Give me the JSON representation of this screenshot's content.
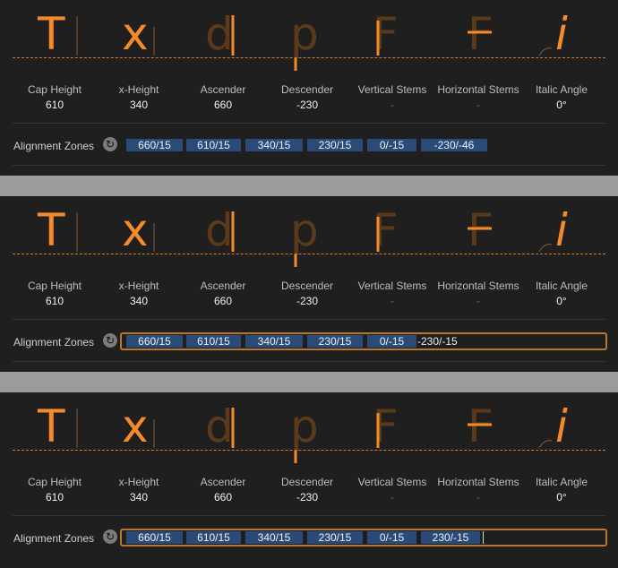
{
  "metrics": [
    {
      "label": "Cap Height",
      "value": "610"
    },
    {
      "label": "x-Height",
      "value": "340"
    },
    {
      "label": "Ascender",
      "value": "660"
    },
    {
      "label": "Descender",
      "value": "-230"
    },
    {
      "label": "Vertical Stems",
      "value": "-"
    },
    {
      "label": "Horizontal Stems",
      "value": "-"
    },
    {
      "label": "Italic Angle",
      "value": "0°"
    }
  ],
  "glyphs": [
    "T",
    "x",
    "d",
    "p",
    "F",
    "F",
    "i"
  ],
  "alignment_label": "Alignment Zones",
  "reset_icon": "↻",
  "colors": {
    "accent": "#f48a2a",
    "dim": "#5b3a1a",
    "zone": "#2a4a78",
    "frame": "#b6782f"
  },
  "panels": [
    {
      "zones": [
        "660/15",
        "610/15",
        "340/15",
        "230/15",
        "0/-15",
        "-230/-46"
      ],
      "editing": ""
    },
    {
      "zones": [
        "660/15",
        "610/15",
        "340/15",
        "230/15",
        "0/-15"
      ],
      "editing": "-230/-15"
    },
    {
      "zones": [
        "660/15",
        "610/15",
        "340/15",
        "230/15",
        "0/-15",
        "230/-15"
      ],
      "editing": ""
    }
  ]
}
